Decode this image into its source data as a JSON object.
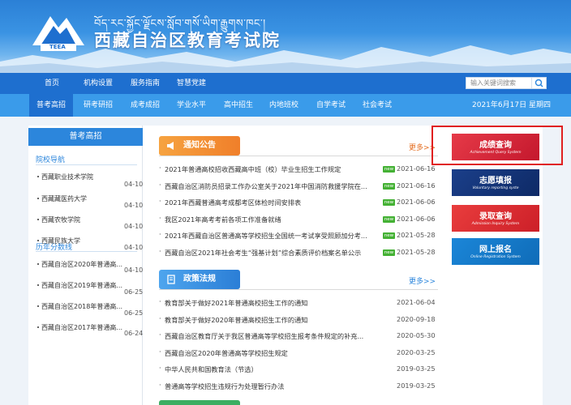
{
  "header": {
    "tibetan_title": "བོད་རང་སྐྱོང་ལྗོངས་སློབ་གསོ་ཡིག་རྒྱུགས་ཁང་།",
    "site_title": "西藏自治区教育考试院",
    "logo_text": "TEEA"
  },
  "nav_primary": [
    "首页",
    "机构设置",
    "服务指南",
    "智慧党建"
  ],
  "search": {
    "placeholder": "输入关键词搜索"
  },
  "nav_secondary": [
    "普考高招",
    "研考研招",
    "成考成招",
    "学业水平",
    "高中招生",
    "内地班校",
    "自学考试",
    "社会考试"
  ],
  "date_text": "2021年6月17日 星期四",
  "left": {
    "tab_title": "普考高招",
    "section1_title": "院校导航",
    "section1_items": [
      {
        "text": "西藏职业技术学院",
        "date": "04-10"
      },
      {
        "text": "西藏藏医药大学",
        "date": "04-10"
      },
      {
        "text": "西藏农牧学院",
        "date": "04-10"
      },
      {
        "text": "西藏民族大学",
        "date": "04-10"
      }
    ],
    "section2_title": "历年分数线",
    "section2_items": [
      {
        "text": "西藏自治区2020年普通高...",
        "date": "04-10"
      },
      {
        "text": "西藏自治区2019年普通高...",
        "date": "06-25"
      },
      {
        "text": "西藏自治区2018年普通高...",
        "date": "06-25"
      },
      {
        "text": "西藏自治区2017年普通高...",
        "date": "06-24"
      }
    ]
  },
  "notices": {
    "title": "通知公告",
    "more": "更多>>",
    "badge": "new",
    "items": [
      {
        "title": "2021年普通高校招收西藏高中班（校）毕业生招生工作规定",
        "date": "2021-06-16",
        "new": true
      },
      {
        "title": "西藏自治区消防员招录工作办公室关于2021年中国消防救援学院在...",
        "date": "2021-06-16",
        "new": true
      },
      {
        "title": "2021年西藏普通高考成都考区体检时间安排表",
        "date": "2021-06-06",
        "new": true
      },
      {
        "title": "我区2021年高考考前各项工作准备就绪",
        "date": "2021-06-06",
        "new": true
      },
      {
        "title": "2021年西藏自治区普通高等学校招生全国统一考试享受照顾加分考...",
        "date": "2021-05-28",
        "new": true
      },
      {
        "title": "西藏自治区2021年社会考生“强基计划”综合素质评价档案名单公示",
        "date": "2021-05-28",
        "new": true
      }
    ]
  },
  "policies": {
    "title": "政策法规",
    "more": "更多>>",
    "items": [
      {
        "title": "教育部关于做好2021年普通高校招生工作的通知",
        "date": "2021-06-04"
      },
      {
        "title": "教育部关于做好2020年普通高校招生工作的通知",
        "date": "2020-09-18"
      },
      {
        "title": "西藏自治区教育厅关于我区普通高等学校招生报考条件规定的补充...",
        "date": "2020-05-30"
      },
      {
        "title": "西藏自治区2020年普通高等学校招生规定",
        "date": "2020-03-25"
      },
      {
        "title": "中华人民共和国教育法（节选）",
        "date": "2019-03-25"
      },
      {
        "title": "普通高等学校招生违规行为处理暂行办法",
        "date": "2019-03-25"
      }
    ]
  },
  "quick_links": [
    {
      "label": "成绩查询",
      "sub": "Achievement Query System"
    },
    {
      "label": "志愿填报",
      "sub": "Voluntary reporting syste"
    },
    {
      "label": "录取查询",
      "sub": "Admission Inquiry System"
    },
    {
      "label": "网上报名",
      "sub": "Online Registration System"
    }
  ]
}
